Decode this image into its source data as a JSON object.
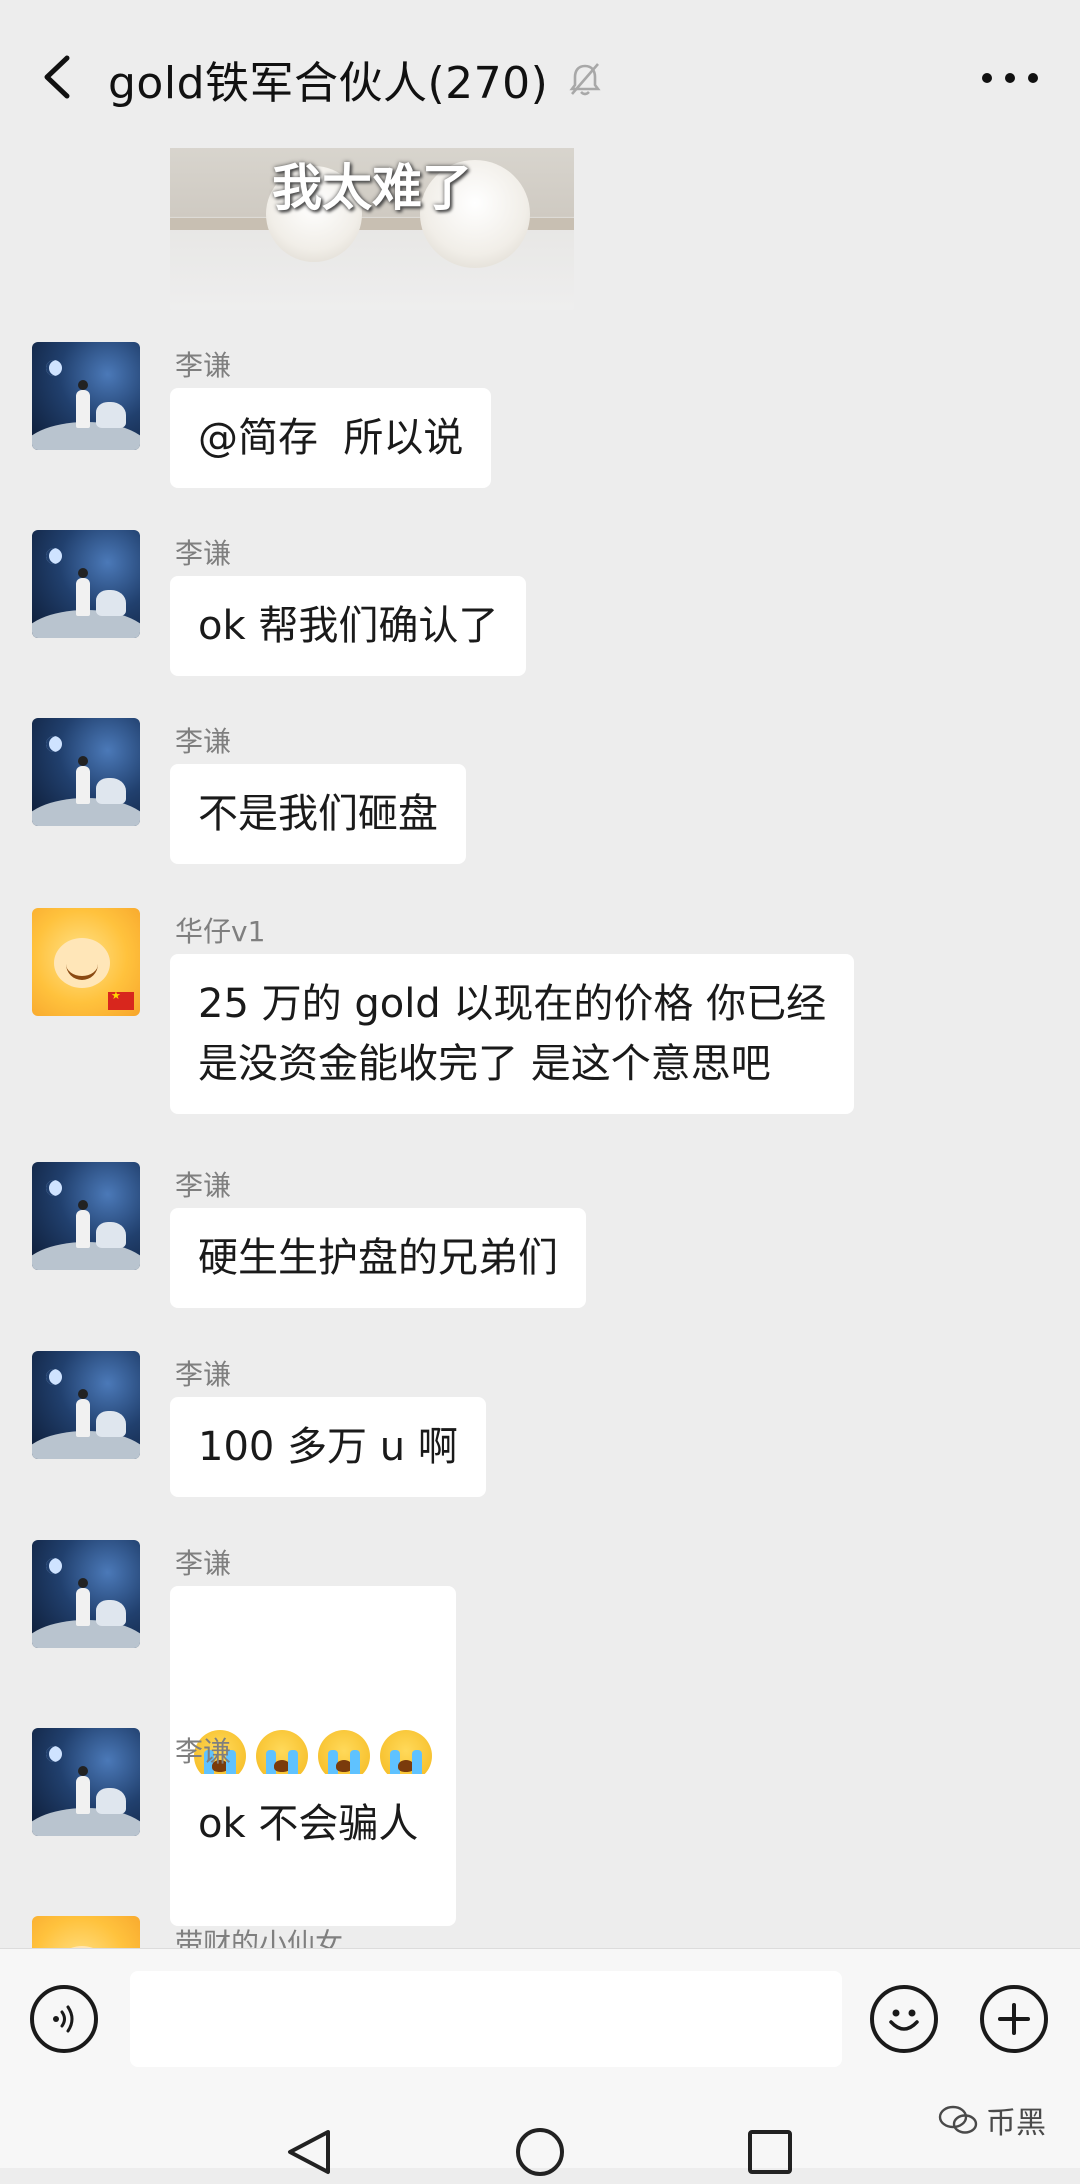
{
  "header": {
    "title": "gold铁军合伙人(270)"
  },
  "sticker": {
    "text": "我太难了"
  },
  "messages": [
    {
      "sender": "李谦",
      "text": "@简存  所以说"
    },
    {
      "sender": "李谦",
      "text": "ok 帮我们确认了"
    },
    {
      "sender": "李谦",
      "text": "不是我们砸盘"
    },
    {
      "sender": "华仔v1",
      "text": "25 万的 gold 以现在的价格 你已经\n是没资金能收完了 是这个意思吧"
    },
    {
      "sender": "李谦",
      "text": "硬生生护盘的兄弟们"
    },
    {
      "sender": "李谦",
      "text": "100 多万 u 啊"
    },
    {
      "sender": "李谦",
      "emoji_count": 4
    },
    {
      "sender": "李谦",
      "text": "ok 不会骗人"
    }
  ],
  "partial_sender": "带财的小仙女",
  "input": {
    "value": ""
  },
  "watermark": {
    "text": "币黑"
  }
}
